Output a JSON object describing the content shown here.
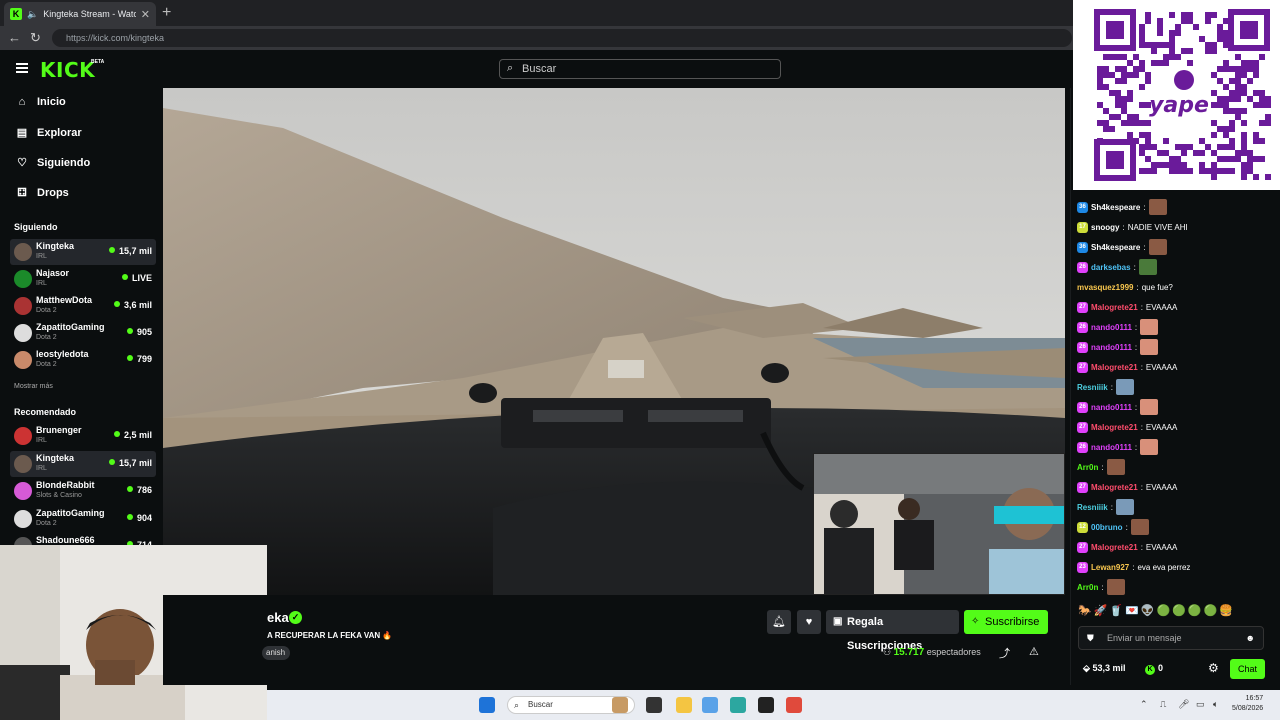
{
  "browser": {
    "tab_title": "Kingteka Stream - Watch Live",
    "tab_close": "✕",
    "new_tab": "+",
    "url": "https://kick.com/kingteka"
  },
  "header": {
    "logo": "KICK",
    "beta": "BETA",
    "search_placeholder": "Buscar"
  },
  "sidebar": {
    "nav": [
      {
        "label": "Inicio",
        "icon": "home-icon"
      },
      {
        "label": "Explorar",
        "icon": "browse-icon"
      },
      {
        "label": "Siguiendo",
        "icon": "heart-icon"
      },
      {
        "label": "Drops",
        "icon": "drops-icon"
      }
    ],
    "following_title": "Siguiendo",
    "following": [
      {
        "name": "Kingteka",
        "category": "IRL",
        "viewers": "15,7 mil"
      },
      {
        "name": "Najasor",
        "category": "IRL",
        "viewers": "LIVE"
      },
      {
        "name": "MatthewDota",
        "category": "Dota 2",
        "viewers": "3,6 mil"
      },
      {
        "name": "ZapatitoGaming",
        "category": "Dota 2",
        "viewers": "905"
      },
      {
        "name": "leostyledota",
        "category": "Dota 2",
        "viewers": "799"
      }
    ],
    "show_more": "Mostrar más",
    "recommended_title": "Recomendado",
    "recommended": [
      {
        "name": "Brunenger",
        "category": "IRL",
        "viewers": "2,5 mil"
      },
      {
        "name": "Kingteka",
        "category": "IRL",
        "viewers": "15,7 mil"
      },
      {
        "name": "BlondeRabbit",
        "category": "Slots & Casino",
        "viewers": "786"
      },
      {
        "name": "ZapatitoGaming",
        "category": "Dota 2",
        "viewers": "904"
      },
      {
        "name": "Shadoune666",
        "category": "",
        "viewers": "714"
      }
    ]
  },
  "stream": {
    "channel_name": "eka",
    "title": "A RECUPERAR LA FEKA VAN 🔥",
    "language": "anish",
    "viewers_count": "15.717",
    "viewers_label": "espectadores",
    "gift_button": "Regala Suscripciones",
    "subscribe_button": "Suscribirse"
  },
  "chat": {
    "messages": [
      {
        "badge": "36",
        "badge_color": "#1e88e5",
        "user": "Sh4kespeare",
        "user_color": "#ffffff",
        "text": "",
        "emote": "#8a5a44"
      },
      {
        "badge": "17",
        "badge_color": "#cddc39",
        "user": "snoogy",
        "user_color": "#ffffff",
        "text": "NADIE VIVE AHI",
        "emote": ""
      },
      {
        "badge": "36",
        "badge_color": "#1e88e5",
        "user": "Sh4kespeare",
        "user_color": "#ffffff",
        "text": "",
        "emote": "#8a5a44"
      },
      {
        "badge": "26",
        "badge_color": "#e040fb",
        "user": "darksebas",
        "user_color": "#4fc3f7",
        "text": "",
        "emote": "#4a7a3a"
      },
      {
        "badge": "",
        "badge_color": "",
        "user": "mvasquez1999",
        "user_color": "#f9c74f",
        "text": "que fue?",
        "emote": ""
      },
      {
        "badge": "27",
        "badge_color": "#e040fb",
        "user": "Malogrete21",
        "user_color": "#ff4d6d",
        "text": "EVAAAA",
        "emote": ""
      },
      {
        "badge": "26",
        "badge_color": "#e040fb",
        "user": "nando0111",
        "user_color": "#e040fb",
        "text": "",
        "emote": "#d8907a"
      },
      {
        "badge": "26",
        "badge_color": "#e040fb",
        "user": "nando0111",
        "user_color": "#e040fb",
        "text": "",
        "emote": "#d8907a"
      },
      {
        "badge": "27",
        "badge_color": "#e040fb",
        "user": "Malogrete21",
        "user_color": "#ff4d6d",
        "text": "EVAAAA",
        "emote": ""
      },
      {
        "badge": "",
        "badge_color": "",
        "user": "Resniiik",
        "user_color": "#4dd0e1",
        "text": "",
        "emote": "#7a9ab8"
      },
      {
        "badge": "26",
        "badge_color": "#e040fb",
        "user": "nando0111",
        "user_color": "#e040fb",
        "text": "",
        "emote": "#d8907a"
      },
      {
        "badge": "27",
        "badge_color": "#e040fb",
        "user": "Malogrete21",
        "user_color": "#ff4d6d",
        "text": "EVAAAA",
        "emote": ""
      },
      {
        "badge": "26",
        "badge_color": "#e040fb",
        "user": "nando0111",
        "user_color": "#e040fb",
        "text": "",
        "emote": "#d8907a"
      },
      {
        "badge": "",
        "badge_color": "",
        "user": "Arr0n",
        "user_color": "#53fc18",
        "text": "",
        "emote": "#8a5a44"
      },
      {
        "badge": "27",
        "badge_color": "#e040fb",
        "user": "Malogrete21",
        "user_color": "#ff4d6d",
        "text": "EVAAAA",
        "emote": ""
      },
      {
        "badge": "",
        "badge_color": "",
        "user": "Resniiik",
        "user_color": "#4dd0e1",
        "text": "",
        "emote": "#7a9ab8"
      },
      {
        "badge": "12",
        "badge_color": "#cddc39",
        "user": "00bruno",
        "user_color": "#4fc3f7",
        "text": "",
        "emote": "#8a5a44"
      },
      {
        "badge": "27",
        "badge_color": "#e040fb",
        "user": "Malogrete21",
        "user_color": "#ff4d6d",
        "text": "EVAAAA",
        "emote": ""
      },
      {
        "badge": "23",
        "badge_color": "#e040fb",
        "user": "Lewan927",
        "user_color": "#f9c74f",
        "text": "eva eva perrez",
        "emote": ""
      },
      {
        "badge": "",
        "badge_color": "",
        "user": "Arr0n",
        "user_color": "#53fc18",
        "text": "",
        "emote": "#8a5a44"
      }
    ],
    "input_placeholder": "Enviar un mensaje",
    "points": "53,3 mil",
    "kick_points": "0",
    "chat_button": "Chat"
  },
  "qr": {
    "brand": "yape"
  },
  "taskbar": {
    "search_placeholder": "Buscar",
    "time": "16:57",
    "date": "5/08/2026"
  }
}
